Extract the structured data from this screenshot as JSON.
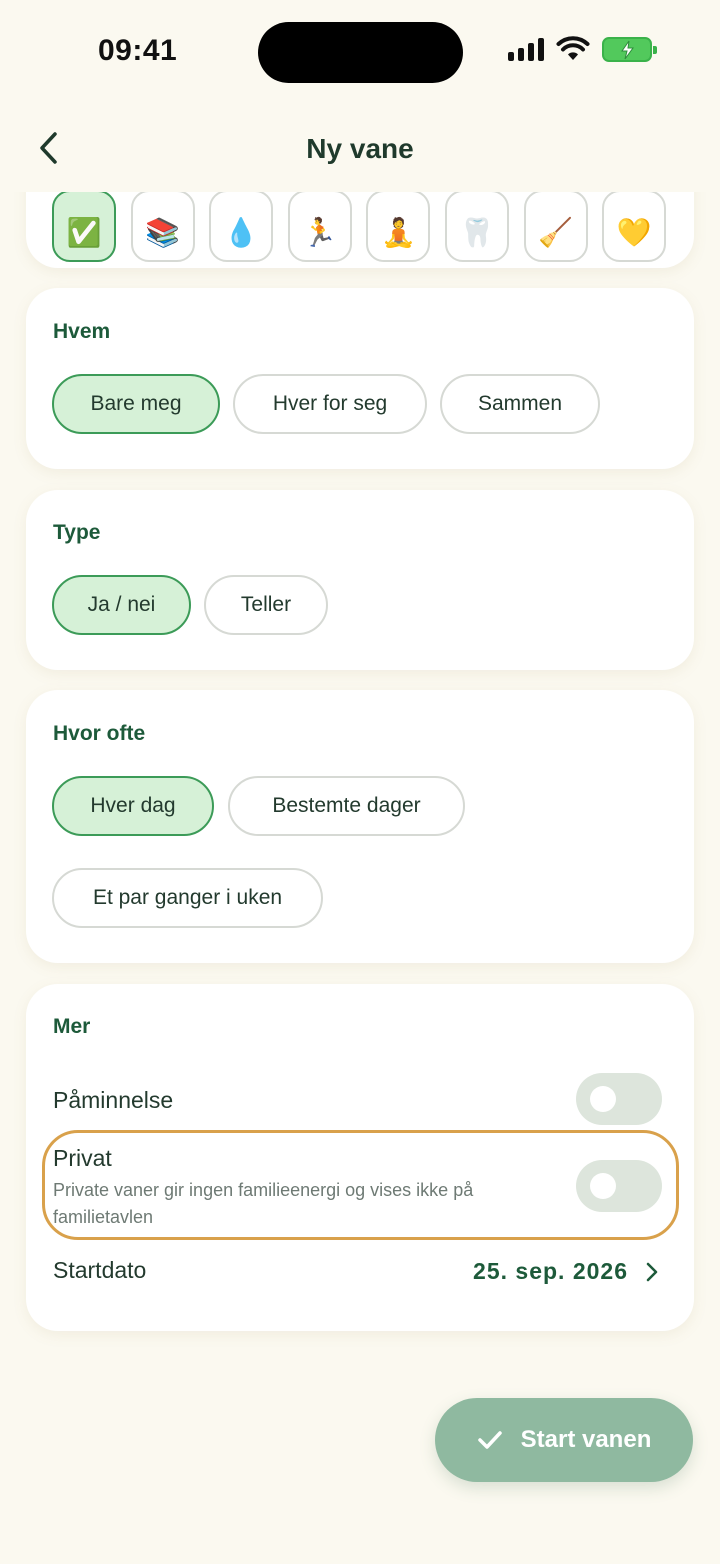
{
  "status": {
    "time": "09:41"
  },
  "header": {
    "title": "Ny vane"
  },
  "icons": {
    "items": [
      {
        "name": "check",
        "glyph": "✅",
        "selected": true
      },
      {
        "name": "books",
        "glyph": "📚"
      },
      {
        "name": "droplet",
        "glyph": "💧"
      },
      {
        "name": "runner",
        "glyph": "🏃"
      },
      {
        "name": "meditation",
        "glyph": "🧘"
      },
      {
        "name": "tooth",
        "glyph": "🦷"
      },
      {
        "name": "broom",
        "glyph": "🧹"
      },
      {
        "name": "heart",
        "glyph": "💛"
      }
    ]
  },
  "who": {
    "title": "Hvem",
    "options": [
      "Bare meg",
      "Hver for seg",
      "Sammen"
    ],
    "selected": "Bare meg"
  },
  "type": {
    "title": "Type",
    "options": [
      "Ja / nei",
      "Teller"
    ],
    "selected": "Ja / nei"
  },
  "frequency": {
    "title": "Hvor ofte",
    "options": [
      "Hver dag",
      "Bestemte dager",
      "Et par ganger i uken"
    ],
    "selected": "Hver dag"
  },
  "more": {
    "title": "Mer",
    "reminder": {
      "label": "Påminnelse",
      "on": false
    },
    "private": {
      "label": "Privat",
      "description": "Private vaner gir ingen familieenergi og vises ikke på familietavlen",
      "on": false
    },
    "start_date": {
      "label": "Startdato",
      "value": "25. sep. 2026"
    }
  },
  "start_button": {
    "label": "Start vanen"
  },
  "colors": {
    "accent": "#1d5a3a",
    "chip_selected_bg": "#d6f1d7",
    "chip_selected_border": "#3c9b58",
    "button_bg": "#8fb9a0",
    "highlight": "#d9a14b",
    "background": "#fbf9f0"
  }
}
